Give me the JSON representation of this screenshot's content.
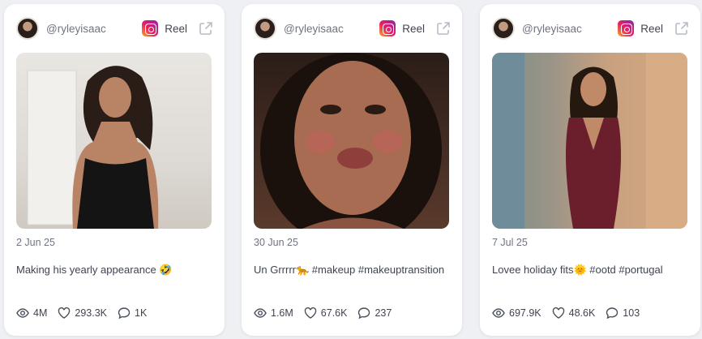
{
  "cards": [
    {
      "handle": "@ryleyisaac",
      "platform_icon": "instagram-icon",
      "type_label": "Reel",
      "date": "2 Jun 25",
      "caption": "Making his yearly appearance 🤣",
      "views": "4M",
      "likes": "293.3K",
      "comments": "1K"
    },
    {
      "handle": "@ryleyisaac",
      "platform_icon": "instagram-icon",
      "type_label": "Reel",
      "date": "30 Jun 25",
      "caption": "Un Grrrrr🐆 #makeup #makeuptransition",
      "views": "1.6M",
      "likes": "67.6K",
      "comments": "237"
    },
    {
      "handle": "@ryleyisaac",
      "platform_icon": "instagram-icon",
      "type_label": "Reel",
      "date": "7 Jul 25",
      "caption": "Lovee holiday fits🌞 #ootd #portugal",
      "views": "697.9K",
      "likes": "48.6K",
      "comments": "103"
    }
  ],
  "colors": {
    "background": "#eef0f4",
    "card": "#ffffff",
    "text": "#3f4450",
    "muted": "#6f7480"
  }
}
